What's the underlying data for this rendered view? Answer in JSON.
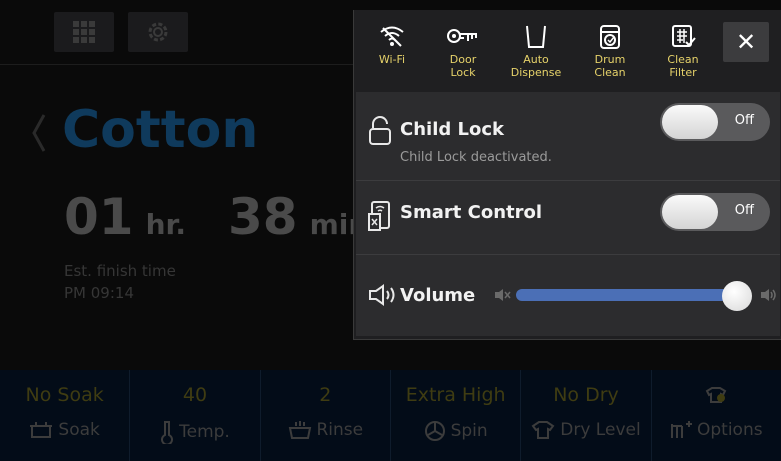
{
  "main": {
    "cycle_name": "Cotton",
    "time": {
      "hours": "01",
      "hours_unit": "hr.",
      "minutes": "38",
      "minutes_unit": "min."
    },
    "finish": {
      "label": "Est. finish time",
      "time": "PM 09:14"
    },
    "top_buttons": [
      {
        "icon": "grid-icon"
      },
      {
        "icon": "gear-icon"
      }
    ],
    "options": [
      {
        "value": "No Soak",
        "label": "Soak",
        "icon": "soak-icon"
      },
      {
        "value": "40",
        "label": "Temp.",
        "icon": "thermometer-icon"
      },
      {
        "value": "2",
        "label": "Rinse",
        "icon": "rinse-icon"
      },
      {
        "value": "Extra High",
        "label": "Spin",
        "icon": "spin-icon"
      },
      {
        "value": "No Dry",
        "label": "Dry Level",
        "icon": "shirt-icon"
      },
      {
        "value": "",
        "label": "Options",
        "icon": "options-icon"
      }
    ]
  },
  "panel": {
    "quick": [
      {
        "label": "Wi-Fi",
        "icon": "wifi-off-icon"
      },
      {
        "label": "Door\nLock",
        "icon": "key-icon"
      },
      {
        "label": "Auto\nDispense",
        "icon": "dispenser-icon"
      },
      {
        "label": "Drum\nClean",
        "icon": "drum-icon"
      },
      {
        "label": "Clean\nFilter",
        "icon": "filter-icon"
      }
    ],
    "close_label": "✕",
    "child_lock": {
      "title": "Child Lock",
      "subtitle": "Child Lock deactivated.",
      "toggle": "Off"
    },
    "smart_control": {
      "title": "Smart Control",
      "toggle": "Off"
    },
    "volume": {
      "title": "Volume",
      "level_percent": 95
    }
  },
  "colors": {
    "accent_yellow": "#e6d26a",
    "slider_blue": "#4b6fb6",
    "cycle_blue": "#0f3a5c"
  }
}
